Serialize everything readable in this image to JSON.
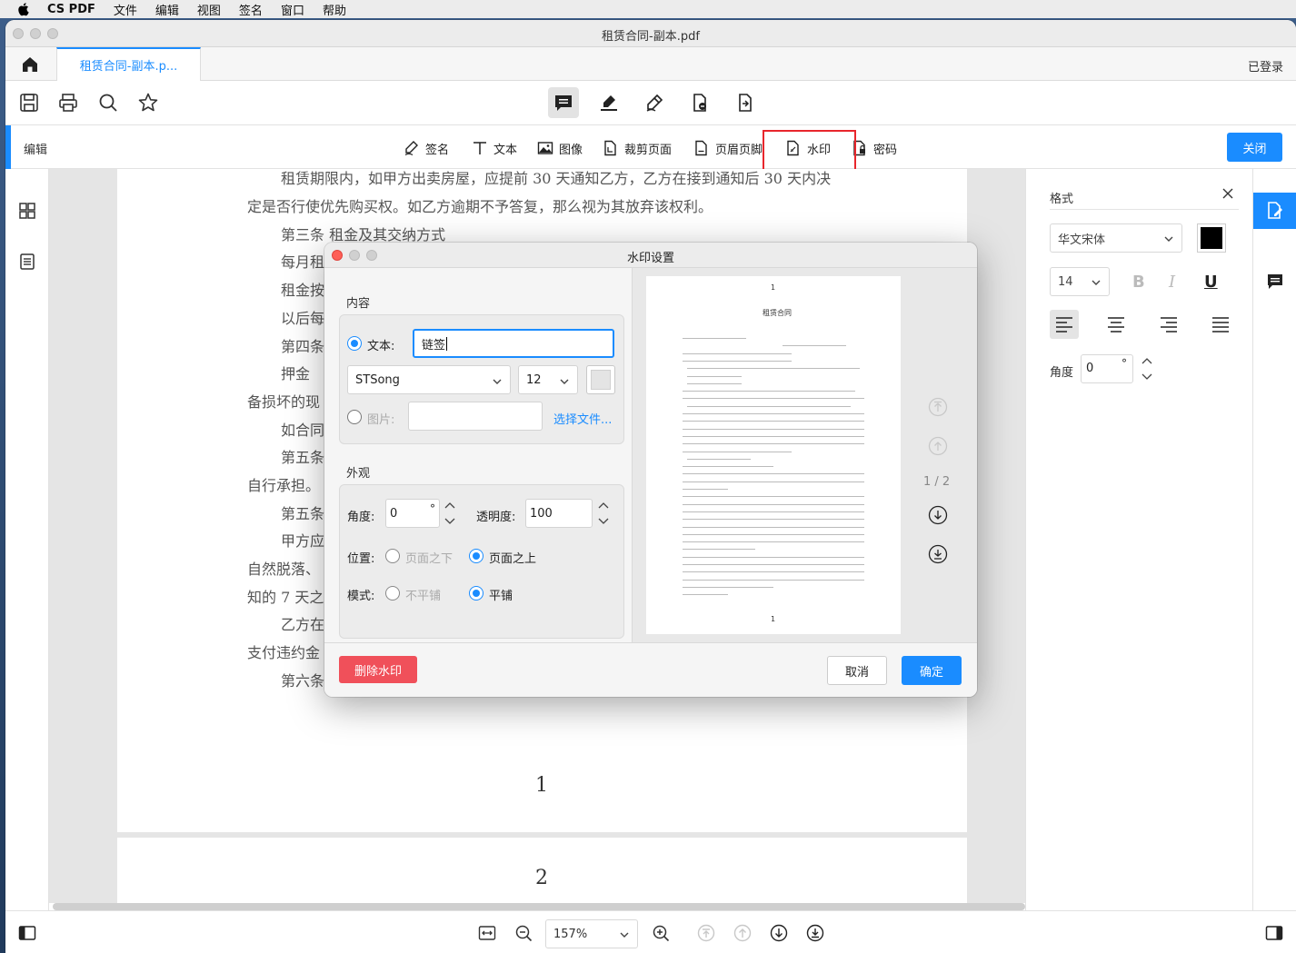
{
  "menubar": {
    "app_name": "CS PDF",
    "items": [
      "文件",
      "编辑",
      "视图",
      "签名",
      "窗口",
      "帮助"
    ]
  },
  "window": {
    "title": "租赁合同-副本.pdf",
    "tab_label": "租赁合同-副本.p...",
    "login_status": "已登录"
  },
  "editbar": {
    "label": "编辑",
    "tools": [
      "签名",
      "文本",
      "图像",
      "裁剪页面",
      "页眉页脚",
      "水印",
      "密码"
    ],
    "close_label": "关闭"
  },
  "document": {
    "lines": [
      "租赁期限内，如甲方出卖房屋，应提前 30 天通知乙方，乙方在接到通知后 30 天内决",
      "定是否行使优先购买权。如乙方逾期不予答复，那么视为其放弃该权利。",
      "第三条  租金及其交纳方式",
      "每月租",
      "租金按",
      "以后每",
      "第四条",
      "押金",
      "备损坏的现",
      "如合同",
      "第五条",
      "自行承担。",
      "第五条",
      "甲方应",
      "自然脱落、",
      "知的 7 天之",
      "乙方在",
      "支付违约金",
      "第六条"
    ],
    "page1_number": "1",
    "page2_number": "2"
  },
  "format_panel": {
    "title": "格式",
    "font": "华文宋体",
    "size": "14",
    "bold": "B",
    "italic": "I",
    "underline": "U",
    "color": "#000000",
    "angle_label": "角度",
    "angle_value": "0",
    "degree": "°"
  },
  "bottombar": {
    "zoom": "157%"
  },
  "dialog": {
    "title": "水印设置",
    "content_label": "内容",
    "text_label": "文本:",
    "text_value": "链签",
    "font": "STSong",
    "font_size": "12",
    "image_label": "图片:",
    "choose_file": "选择文件...",
    "appearance_label": "外观",
    "angle_label": "角度:",
    "angle_value": "0",
    "degree": "°",
    "opacity_label": "透明度:",
    "opacity_value": "100",
    "position_label": "位置:",
    "below_page": "页面之下",
    "above_page": "页面之上",
    "mode_label": "模式:",
    "no_tile": "不平铺",
    "tile": "平铺",
    "preview_page_num": "1",
    "preview_title": "租赁合同",
    "preview_footer_num": "1",
    "page_indicator": "1 / 2",
    "delete_button": "删除水印",
    "cancel_button": "取消",
    "ok_button": "确定"
  }
}
